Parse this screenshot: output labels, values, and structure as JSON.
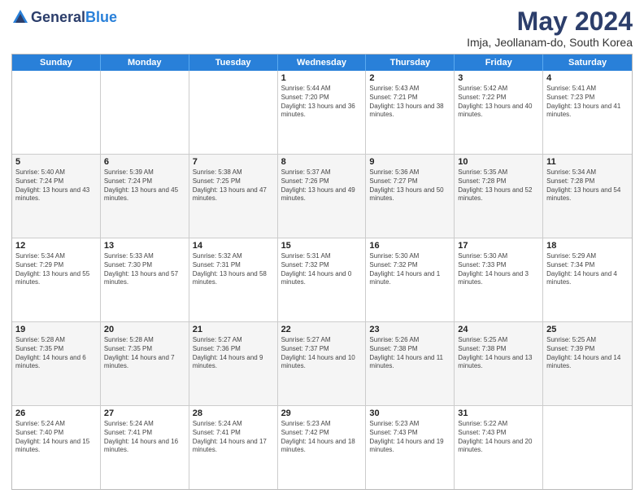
{
  "header": {
    "logo_general": "General",
    "logo_blue": "Blue",
    "title": "May 2024",
    "location": "Imja, Jeollanam-do, South Korea"
  },
  "days_of_week": [
    "Sunday",
    "Monday",
    "Tuesday",
    "Wednesday",
    "Thursday",
    "Friday",
    "Saturday"
  ],
  "rows": [
    [
      {
        "day": "",
        "sunrise": "",
        "sunset": "",
        "daylight": ""
      },
      {
        "day": "",
        "sunrise": "",
        "sunset": "",
        "daylight": ""
      },
      {
        "day": "",
        "sunrise": "",
        "sunset": "",
        "daylight": ""
      },
      {
        "day": "1",
        "sunrise": "Sunrise: 5:44 AM",
        "sunset": "Sunset: 7:20 PM",
        "daylight": "Daylight: 13 hours and 36 minutes."
      },
      {
        "day": "2",
        "sunrise": "Sunrise: 5:43 AM",
        "sunset": "Sunset: 7:21 PM",
        "daylight": "Daylight: 13 hours and 38 minutes."
      },
      {
        "day": "3",
        "sunrise": "Sunrise: 5:42 AM",
        "sunset": "Sunset: 7:22 PM",
        "daylight": "Daylight: 13 hours and 40 minutes."
      },
      {
        "day": "4",
        "sunrise": "Sunrise: 5:41 AM",
        "sunset": "Sunset: 7:23 PM",
        "daylight": "Daylight: 13 hours and 41 minutes."
      }
    ],
    [
      {
        "day": "5",
        "sunrise": "Sunrise: 5:40 AM",
        "sunset": "Sunset: 7:24 PM",
        "daylight": "Daylight: 13 hours and 43 minutes."
      },
      {
        "day": "6",
        "sunrise": "Sunrise: 5:39 AM",
        "sunset": "Sunset: 7:24 PM",
        "daylight": "Daylight: 13 hours and 45 minutes."
      },
      {
        "day": "7",
        "sunrise": "Sunrise: 5:38 AM",
        "sunset": "Sunset: 7:25 PM",
        "daylight": "Daylight: 13 hours and 47 minutes."
      },
      {
        "day": "8",
        "sunrise": "Sunrise: 5:37 AM",
        "sunset": "Sunset: 7:26 PM",
        "daylight": "Daylight: 13 hours and 49 minutes."
      },
      {
        "day": "9",
        "sunrise": "Sunrise: 5:36 AM",
        "sunset": "Sunset: 7:27 PM",
        "daylight": "Daylight: 13 hours and 50 minutes."
      },
      {
        "day": "10",
        "sunrise": "Sunrise: 5:35 AM",
        "sunset": "Sunset: 7:28 PM",
        "daylight": "Daylight: 13 hours and 52 minutes."
      },
      {
        "day": "11",
        "sunrise": "Sunrise: 5:34 AM",
        "sunset": "Sunset: 7:28 PM",
        "daylight": "Daylight: 13 hours and 54 minutes."
      }
    ],
    [
      {
        "day": "12",
        "sunrise": "Sunrise: 5:34 AM",
        "sunset": "Sunset: 7:29 PM",
        "daylight": "Daylight: 13 hours and 55 minutes."
      },
      {
        "day": "13",
        "sunrise": "Sunrise: 5:33 AM",
        "sunset": "Sunset: 7:30 PM",
        "daylight": "Daylight: 13 hours and 57 minutes."
      },
      {
        "day": "14",
        "sunrise": "Sunrise: 5:32 AM",
        "sunset": "Sunset: 7:31 PM",
        "daylight": "Daylight: 13 hours and 58 minutes."
      },
      {
        "day": "15",
        "sunrise": "Sunrise: 5:31 AM",
        "sunset": "Sunset: 7:32 PM",
        "daylight": "Daylight: 14 hours and 0 minutes."
      },
      {
        "day": "16",
        "sunrise": "Sunrise: 5:30 AM",
        "sunset": "Sunset: 7:32 PM",
        "daylight": "Daylight: 14 hours and 1 minute."
      },
      {
        "day": "17",
        "sunrise": "Sunrise: 5:30 AM",
        "sunset": "Sunset: 7:33 PM",
        "daylight": "Daylight: 14 hours and 3 minutes."
      },
      {
        "day": "18",
        "sunrise": "Sunrise: 5:29 AM",
        "sunset": "Sunset: 7:34 PM",
        "daylight": "Daylight: 14 hours and 4 minutes."
      }
    ],
    [
      {
        "day": "19",
        "sunrise": "Sunrise: 5:28 AM",
        "sunset": "Sunset: 7:35 PM",
        "daylight": "Daylight: 14 hours and 6 minutes."
      },
      {
        "day": "20",
        "sunrise": "Sunrise: 5:28 AM",
        "sunset": "Sunset: 7:35 PM",
        "daylight": "Daylight: 14 hours and 7 minutes."
      },
      {
        "day": "21",
        "sunrise": "Sunrise: 5:27 AM",
        "sunset": "Sunset: 7:36 PM",
        "daylight": "Daylight: 14 hours and 9 minutes."
      },
      {
        "day": "22",
        "sunrise": "Sunrise: 5:27 AM",
        "sunset": "Sunset: 7:37 PM",
        "daylight": "Daylight: 14 hours and 10 minutes."
      },
      {
        "day": "23",
        "sunrise": "Sunrise: 5:26 AM",
        "sunset": "Sunset: 7:38 PM",
        "daylight": "Daylight: 14 hours and 11 minutes."
      },
      {
        "day": "24",
        "sunrise": "Sunrise: 5:25 AM",
        "sunset": "Sunset: 7:38 PM",
        "daylight": "Daylight: 14 hours and 13 minutes."
      },
      {
        "day": "25",
        "sunrise": "Sunrise: 5:25 AM",
        "sunset": "Sunset: 7:39 PM",
        "daylight": "Daylight: 14 hours and 14 minutes."
      }
    ],
    [
      {
        "day": "26",
        "sunrise": "Sunrise: 5:24 AM",
        "sunset": "Sunset: 7:40 PM",
        "daylight": "Daylight: 14 hours and 15 minutes."
      },
      {
        "day": "27",
        "sunrise": "Sunrise: 5:24 AM",
        "sunset": "Sunset: 7:41 PM",
        "daylight": "Daylight: 14 hours and 16 minutes."
      },
      {
        "day": "28",
        "sunrise": "Sunrise: 5:24 AM",
        "sunset": "Sunset: 7:41 PM",
        "daylight": "Daylight: 14 hours and 17 minutes."
      },
      {
        "day": "29",
        "sunrise": "Sunrise: 5:23 AM",
        "sunset": "Sunset: 7:42 PM",
        "daylight": "Daylight: 14 hours and 18 minutes."
      },
      {
        "day": "30",
        "sunrise": "Sunrise: 5:23 AM",
        "sunset": "Sunset: 7:43 PM",
        "daylight": "Daylight: 14 hours and 19 minutes."
      },
      {
        "day": "31",
        "sunrise": "Sunrise: 5:22 AM",
        "sunset": "Sunset: 7:43 PM",
        "daylight": "Daylight: 14 hours and 20 minutes."
      },
      {
        "day": "",
        "sunrise": "",
        "sunset": "",
        "daylight": ""
      }
    ]
  ]
}
